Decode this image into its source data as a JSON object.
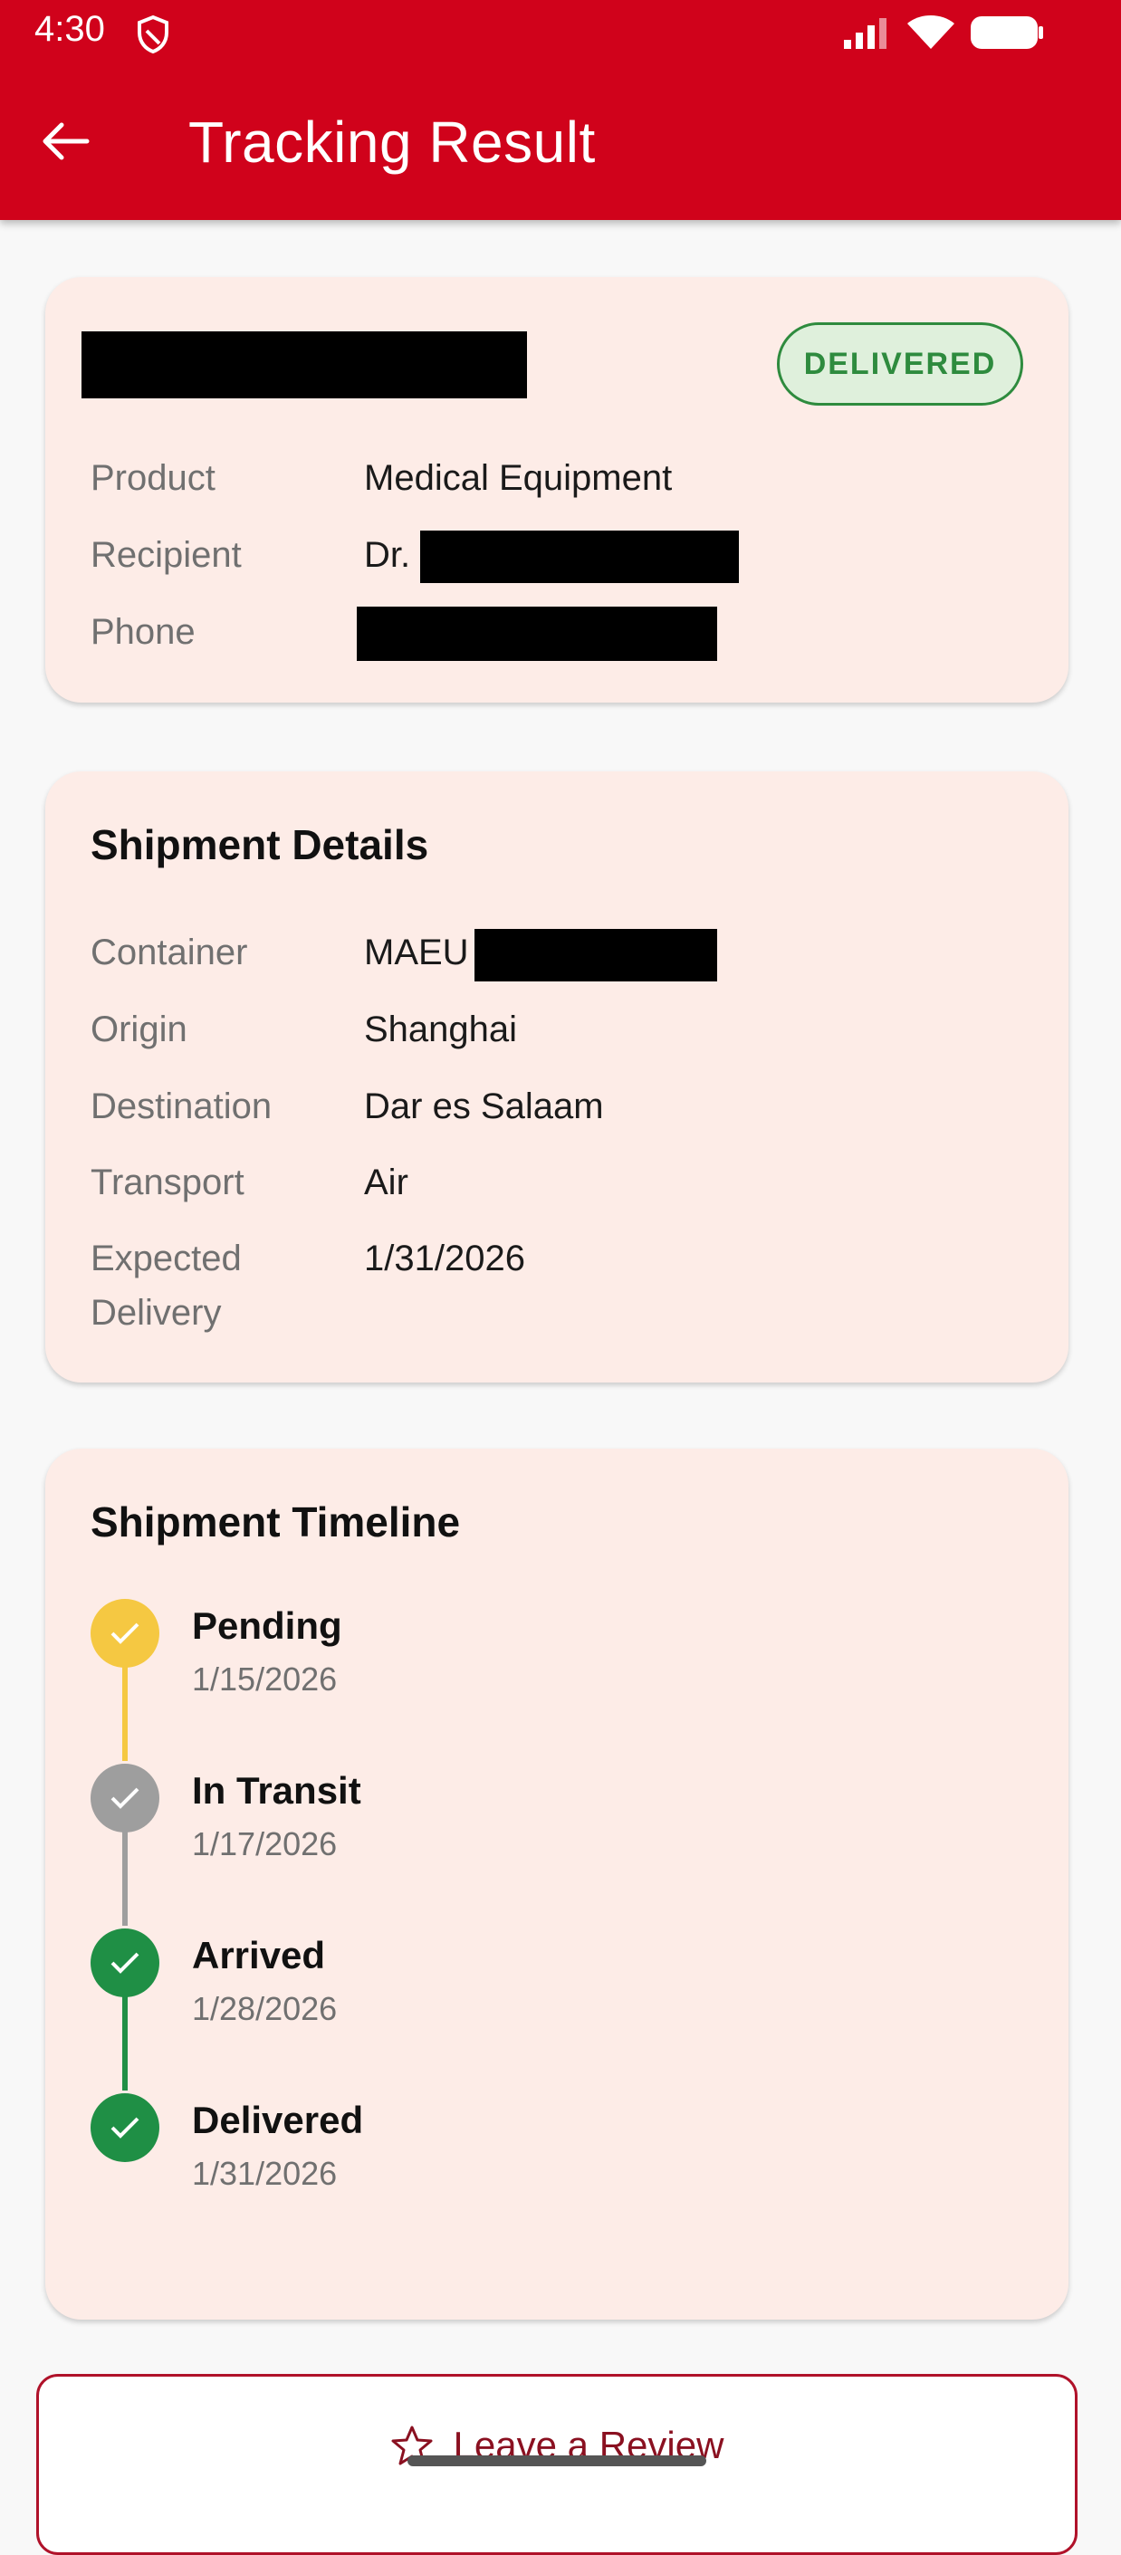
{
  "status_bar": {
    "time": "4:30",
    "icons": [
      "shield-icon",
      "signal-icon",
      "wifi-icon",
      "battery-icon"
    ]
  },
  "app_bar": {
    "back_icon": "arrow-left-icon",
    "title": "Tracking Result",
    "color": "#d0021b"
  },
  "summary_card": {
    "status_badge": "DELIVERED",
    "status_color": "#2e8b3e",
    "rows": [
      {
        "label": "Product",
        "value": "Medical Equipment"
      },
      {
        "label": "Recipient",
        "value": "Dr."
      },
      {
        "label": "Phone",
        "value": ""
      }
    ]
  },
  "details_card": {
    "title": "Shipment Details",
    "rows": [
      {
        "label": "Container",
        "value": "MAEU"
      },
      {
        "label": "Origin",
        "value": "Shanghai"
      },
      {
        "label": "Destination",
        "value": "Dar es Salaam"
      },
      {
        "label": "Transport",
        "value": "Air"
      },
      {
        "label": "Expected Delivery",
        "value": "1/31/2026"
      }
    ]
  },
  "timeline_card": {
    "title": "Shipment Timeline",
    "events": [
      {
        "title": "Pending",
        "date": "1/15/2026",
        "color": "#f5c842"
      },
      {
        "title": "In Transit",
        "date": "1/17/2026",
        "color": "#9e9e9e"
      },
      {
        "title": "Arrived",
        "date": "1/28/2026",
        "color": "#1f8f45"
      },
      {
        "title": "Delivered",
        "date": "1/31/2026",
        "color": "#1f8f45"
      }
    ]
  },
  "review_button": {
    "icon": "star-outline-icon",
    "label": "Leave a Review"
  }
}
